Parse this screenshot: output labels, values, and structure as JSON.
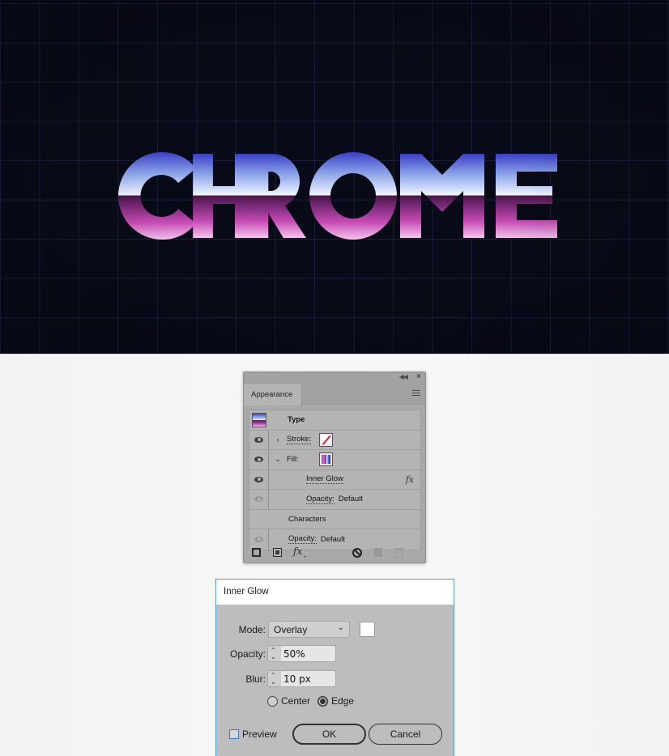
{
  "artwork": {
    "headline": "CHROME",
    "background_color": "#080a17",
    "grid_color": "#282e54",
    "gradient_top": [
      "#3a3fc8",
      "#8fa6e8",
      "#e8eeff"
    ],
    "gradient_bottom": [
      "#4a1548",
      "#c64bb4",
      "#f6c4ee"
    ]
  },
  "appearance_panel": {
    "title": "Appearance",
    "collapse_icon": "double-chevron-left-icon",
    "close_icon": "close-icon",
    "menu_icon": "hamburger-menu-icon",
    "rows": [
      {
        "kind": "object",
        "label": "Type"
      },
      {
        "kind": "attribute",
        "label": "Stroke:",
        "visible": true,
        "expanded": false,
        "swatch": "none-red-slash"
      },
      {
        "kind": "attribute",
        "label": "Fill:",
        "visible": true,
        "expanded": true,
        "swatch": "gradient"
      },
      {
        "kind": "effect",
        "label": "Inner Glow",
        "visible": true,
        "fx": "fx"
      },
      {
        "kind": "sub",
        "label": "Opacity:",
        "value": "Default",
        "visible": false
      },
      {
        "kind": "group",
        "label": "Characters"
      },
      {
        "kind": "sub",
        "label": "Opacity:",
        "value": "Default",
        "visible": false
      }
    ],
    "footer": {
      "add_stroke": "add-new-stroke-icon",
      "add_fill": "add-new-fill-icon",
      "add_effect": "fx",
      "clear": "clear-appearance-icon",
      "duplicate": "duplicate-item-icon",
      "delete": "delete-icon"
    }
  },
  "inner_glow_dialog": {
    "title": "Inner Glow",
    "mode_label": "Mode:",
    "mode_value": "Overlay",
    "glow_color": "#ffffff",
    "opacity_label": "Opacity:",
    "opacity_value": "50%",
    "blur_label": "Blur:",
    "blur_value": "10 px",
    "center_label": "Center",
    "edge_label": "Edge",
    "selected_source": "Edge",
    "preview_label": "Preview",
    "preview_checked": false,
    "ok_label": "OK",
    "cancel_label": "Cancel"
  }
}
